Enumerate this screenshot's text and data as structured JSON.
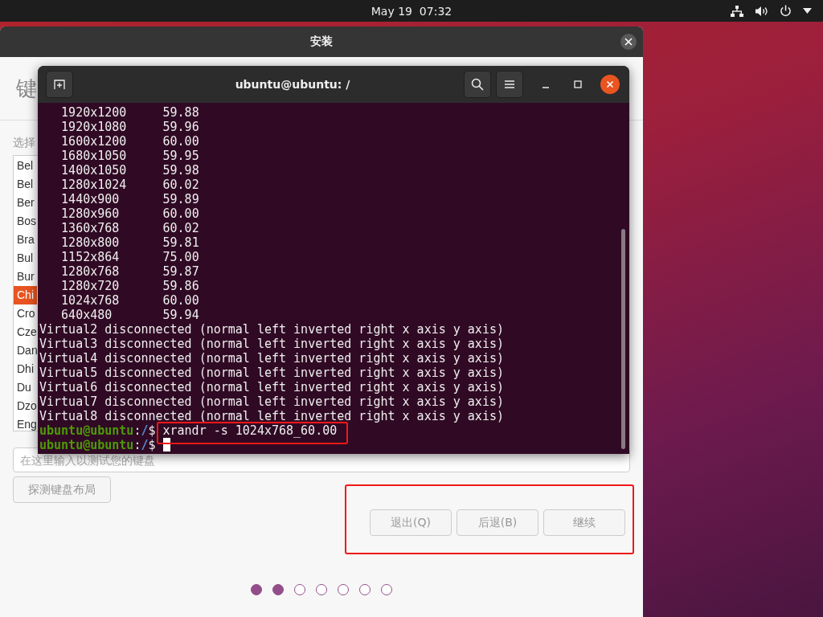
{
  "top_bar": {
    "clock": "May 19  07:32"
  },
  "installer": {
    "title": "安装",
    "heading": "键",
    "prompt": "选择",
    "layouts": [
      {
        "label": "Bel",
        "selected": false
      },
      {
        "label": "Bel",
        "selected": false
      },
      {
        "label": "Ber",
        "selected": false
      },
      {
        "label": "Bos",
        "selected": false
      },
      {
        "label": "Bra",
        "selected": false
      },
      {
        "label": "Bul",
        "selected": false
      },
      {
        "label": "Bur",
        "selected": false
      },
      {
        "label": "Chi",
        "selected": true
      },
      {
        "label": "Cro",
        "selected": false
      },
      {
        "label": "Cze",
        "selected": false
      },
      {
        "label": "Dan",
        "selected": false
      },
      {
        "label": "Dhi",
        "selected": false
      },
      {
        "label": "Du",
        "selected": false
      },
      {
        "label": "Dzo",
        "selected": false
      },
      {
        "label": "Eng",
        "selected": false
      }
    ],
    "test_field": {
      "placeholder": "在这里输入以测试您的键盘"
    },
    "detect_button": "探测键盘布局",
    "buttons": [
      "退出(Q)",
      "后退(B)",
      "继续"
    ],
    "steps": [
      {
        "done": true
      },
      {
        "done": true
      },
      {
        "done": false
      },
      {
        "done": false
      },
      {
        "done": false
      },
      {
        "done": false
      },
      {
        "done": false
      }
    ]
  },
  "terminal": {
    "title": "ubuntu@ubuntu: /",
    "lines": [
      {
        "kind": "output",
        "text": "   1920x1200     59.88"
      },
      {
        "kind": "output",
        "text": "   1920x1080     59.96"
      },
      {
        "kind": "output",
        "text": "   1600x1200     60.00"
      },
      {
        "kind": "output",
        "text": "   1680x1050     59.95"
      },
      {
        "kind": "output",
        "text": "   1400x1050     59.98"
      },
      {
        "kind": "output",
        "text": "   1280x1024     60.02"
      },
      {
        "kind": "output",
        "text": "   1440x900      59.89"
      },
      {
        "kind": "output",
        "text": "   1280x960      60.00"
      },
      {
        "kind": "output",
        "text": "   1360x768      60.02"
      },
      {
        "kind": "output",
        "text": "   1280x800      59.81"
      },
      {
        "kind": "output",
        "text": "   1152x864      75.00"
      },
      {
        "kind": "output",
        "text": "   1280x768      59.87"
      },
      {
        "kind": "output",
        "text": "   1280x720      59.86"
      },
      {
        "kind": "output",
        "text": "   1024x768      60.00"
      },
      {
        "kind": "output",
        "text": "   640x480       59.94"
      },
      {
        "kind": "output",
        "text": "Virtual2 disconnected (normal left inverted right x axis y axis)"
      },
      {
        "kind": "output",
        "text": "Virtual3 disconnected (normal left inverted right x axis y axis)"
      },
      {
        "kind": "output",
        "text": "Virtual4 disconnected (normal left inverted right x axis y axis)"
      },
      {
        "kind": "output",
        "text": "Virtual5 disconnected (normal left inverted right x axis y axis)"
      },
      {
        "kind": "output",
        "text": "Virtual6 disconnected (normal left inverted right x axis y axis)"
      },
      {
        "kind": "output",
        "text": "Virtual7 disconnected (normal left inverted right x axis y axis)"
      },
      {
        "kind": "output",
        "text": "Virtual8 disconnected (normal left inverted right x axis y axis)"
      },
      {
        "kind": "prompt",
        "user": "ubuntu@ubuntu",
        "separator": ":",
        "path": "/",
        "symbol": "$",
        "command": "xrandr -s 1024x768_60.00",
        "cursor": false
      },
      {
        "kind": "prompt",
        "user": "ubuntu@ubuntu",
        "separator": ":",
        "path": "/",
        "symbol": "$",
        "cursor": true
      }
    ]
  }
}
